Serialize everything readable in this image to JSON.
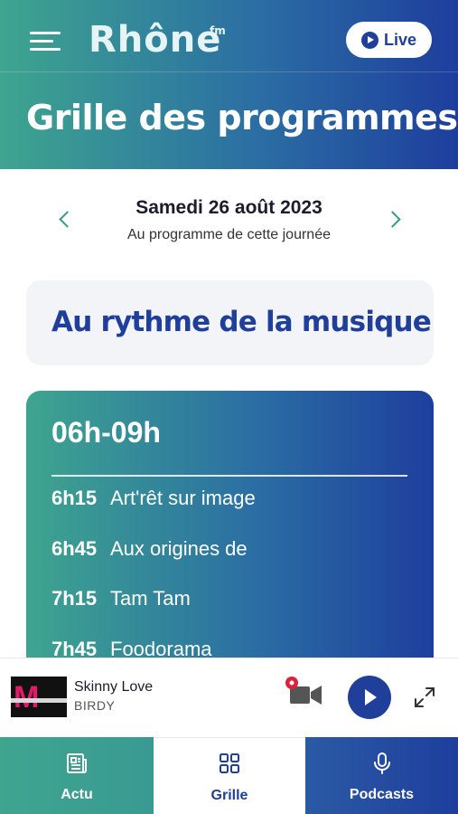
{
  "header": {
    "logo_text": "Rhône",
    "logo_suffix": "fm",
    "live_label": "Live",
    "page_title": "Grille des programmes"
  },
  "date_nav": {
    "date": "Samedi 26 août 2023",
    "subtitle": "Au programme de cette journée"
  },
  "program": {
    "title": "Au rythme de la musique"
  },
  "slot": {
    "time_range": "06h-09h",
    "items": [
      {
        "time": "6h15",
        "name": "Art'rêt sur image"
      },
      {
        "time": "6h45",
        "name": "Aux origines de"
      },
      {
        "time": "7h15",
        "name": "Tam Tam"
      },
      {
        "time": "7h45",
        "name": "Foodorama"
      }
    ]
  },
  "player": {
    "track_title": "Skinny Love",
    "artist": "BIRDY",
    "cover_letter": "M"
  },
  "tabs": [
    {
      "label": "Actu",
      "icon": "newspaper-icon"
    },
    {
      "label": "Grille",
      "icon": "grid-icon"
    },
    {
      "label": "Podcasts",
      "icon": "microphone-icon"
    }
  ],
  "colors": {
    "brand_blue": "#1f3f9b",
    "brand_teal": "#3ea58f",
    "chevron": "#3a9a8c",
    "record_red": "#e0203a"
  }
}
